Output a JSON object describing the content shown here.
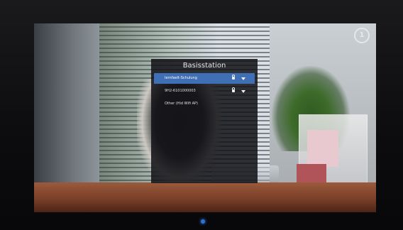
{
  "dialog": {
    "title": "Basisstation",
    "networks": [
      {
        "label": "Iernfaelt-Schulung",
        "icons": [
          "lock-icon",
          "signal-icon"
        ],
        "selected": true
      },
      {
        "label": "9H2-6101000003",
        "icons": [
          "lock-icon",
          "signal-icon"
        ],
        "selected": false
      },
      {
        "label": "Other (Hid Wifi AP)",
        "icons": [],
        "selected": false
      }
    ]
  },
  "colors": {
    "selection": "#3f6fb5",
    "dialog_bg": "#121216",
    "power_led": "#2b6fd8"
  },
  "channel_logo": {
    "icon": "channel-logo-icon"
  }
}
